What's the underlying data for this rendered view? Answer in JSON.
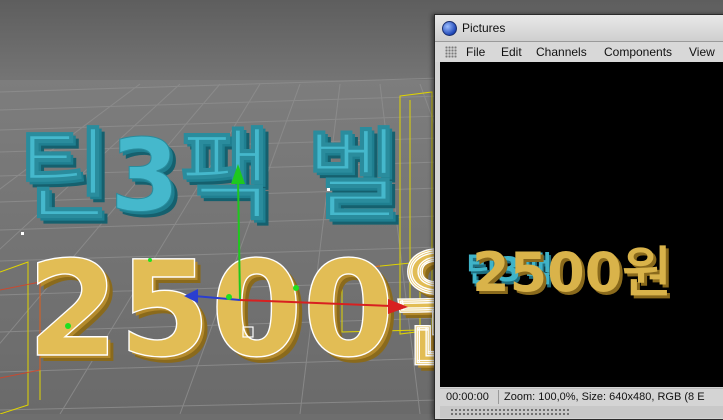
{
  "viewport": {
    "line1": "틴3팩 벨",
    "line2": "2500원",
    "colors": {
      "background": "#6e6e6e",
      "grid": "#8a8a8a",
      "teal": "#3fb3c8",
      "gold": "#d9b34a",
      "wireframe": "#ffffff",
      "bbox": "#e0d400"
    }
  },
  "pictures": {
    "title": "Pictures",
    "menu": [
      "File",
      "Edit",
      "Channels",
      "Components",
      "View"
    ],
    "render_text": {
      "back": "틴3팩",
      "front": "2500원"
    },
    "status_time": "00:00:00",
    "status_info": "Zoom: 100,0%, Size: 640x480, RGB (8 E"
  }
}
